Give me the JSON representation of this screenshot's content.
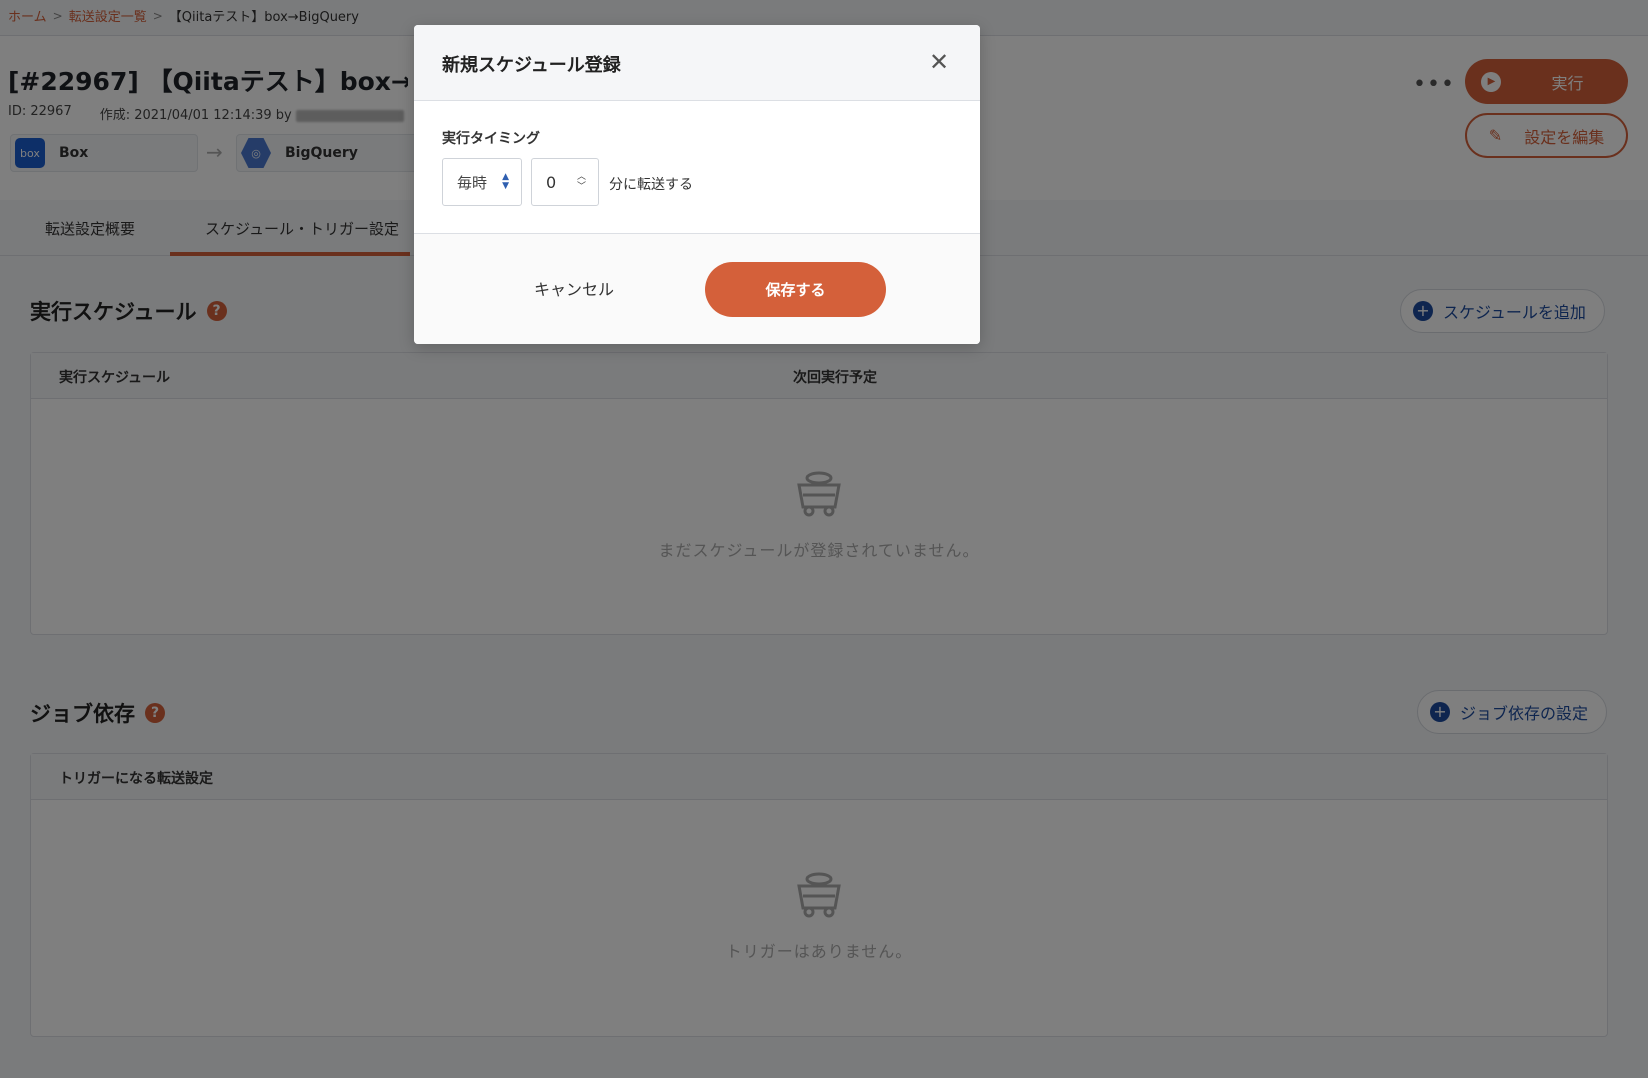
{
  "breadcrumb": {
    "home": "ホーム",
    "list": "転送設定一覧",
    "current": "【Qiitaテスト】box→BigQuery"
  },
  "header": {
    "title": "[#22967] 【Qiitaテスト】box→BigQuery",
    "id_text": "ID: 22967",
    "created_text": "作成: 2021/04/01 12:14:39 by",
    "source_name": "Box",
    "source_logo_text": "box",
    "destination_name": "BigQuery",
    "run_label": "実行",
    "edit_label": "設定を編集"
  },
  "tabs": [
    {
      "label": "転送設定概要"
    },
    {
      "label": "スケジュール・トリガー設定",
      "active": true
    }
  ],
  "schedule_section": {
    "title": "実行スケジュール",
    "add_label": "スケジュールを追加",
    "columns": [
      "実行スケジュール",
      "次回実行予定"
    ],
    "empty_text": "まだスケジュールが登録されていません。"
  },
  "job_dependency_section": {
    "title": "ジョブ依存",
    "add_label": "ジョブ依存の設定",
    "columns": [
      "トリガーになる転送設定"
    ],
    "empty_text": "トリガーはありません。"
  },
  "modal": {
    "title": "新規スケジュール登録",
    "field_label": "実行タイミング",
    "frequency_value": "毎時",
    "minute_value": "0",
    "suffix": "分に転送する",
    "cancel_label": "キャンセル",
    "save_label": "保存する"
  },
  "colors": {
    "accent": "#d4603a",
    "link_blue": "#1c4b9e",
    "overlay": "rgba(0,0,0,0.5)"
  }
}
